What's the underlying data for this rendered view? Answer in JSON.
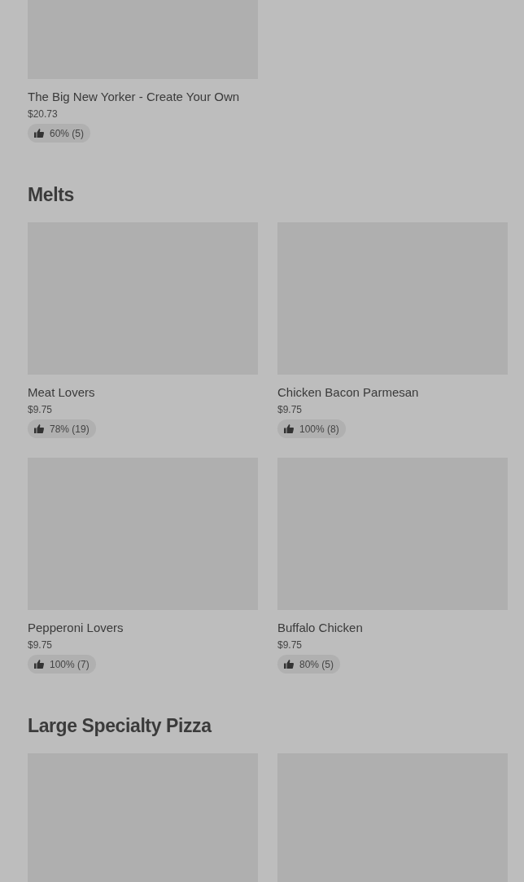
{
  "sections": [
    {
      "items": [
        {
          "kind": "item",
          "name": "The Big New Yorker - Create Your Own",
          "price": "$20.73",
          "rating": "60% (5)"
        }
      ]
    },
    {
      "title": "Melts",
      "items": [
        {
          "kind": "item",
          "name": "Meat Lovers",
          "price": "$9.75",
          "rating": "78% (19)"
        },
        {
          "kind": "item",
          "name": "Chicken Bacon Parmesan",
          "price": "$9.75",
          "rating": "100% (8)"
        },
        {
          "kind": "item",
          "name": "Pepperoni Lovers",
          "price": "$9.75",
          "rating": "100% (7)"
        },
        {
          "kind": "item",
          "name": "Buffalo Chicken",
          "price": "$9.75",
          "rating": "80% (5)"
        }
      ]
    },
    {
      "title": "Large Specialty Pizza",
      "items": [
        {
          "kind": "image_only"
        },
        {
          "kind": "image_only"
        }
      ]
    }
  ]
}
